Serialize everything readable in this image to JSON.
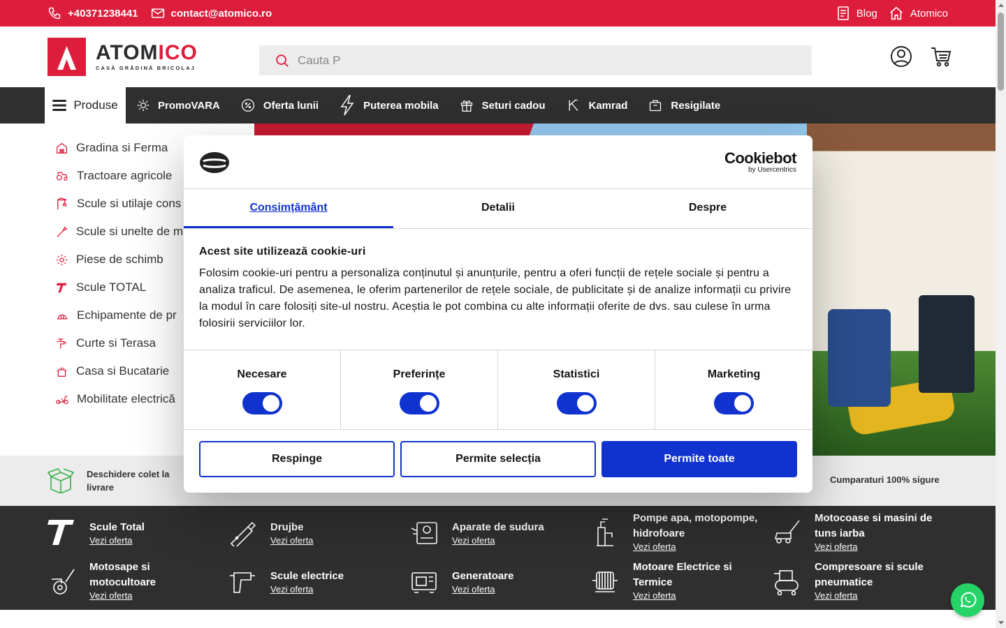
{
  "topbar": {
    "phone": "+40371238441",
    "email": "contact@atomico.ro",
    "blog": "Blog",
    "home": "Atomico"
  },
  "logo": {
    "brand_a": "ATOM",
    "brand_b": "ICO",
    "tagline": "CASĂ GRĂDINĂ BRICOLAJ"
  },
  "search": {
    "placeholder": "Cauta P"
  },
  "nav": {
    "products": "Produse",
    "items": [
      "PromoVARA",
      "Oferta lunii",
      "Puterea mobila",
      "Seturi cadou",
      "Kamrad",
      "Resigilate"
    ]
  },
  "categories": [
    "Gradina si Ferma",
    "Tractoare agricole",
    "Scule si utilaje cons",
    "Scule si unelte de m",
    "Piese de schimb",
    "Scule TOTAL",
    "Echipamente de pr",
    "Curte si Terasa",
    "Casa si Bucatarie",
    "Mobilitate electrică"
  ],
  "benefits": {
    "left": "Deschidere colet la livrare",
    "right": "Cumparaturi 100% sigure"
  },
  "category_grid": [
    {
      "title": "Scule Total",
      "link": "Vezi oferta"
    },
    {
      "title": "Drujbe",
      "link": "Vezi oferta"
    },
    {
      "title": "Aparate de sudura",
      "link": "Vezi oferta"
    },
    {
      "title": "Pompe apa, motopompe, hidrofoare",
      "link": "Vezi oferta"
    },
    {
      "title": "Motocoase si masini de tuns iarba",
      "link": "Vezi oferta"
    },
    {
      "title": "Motosape si motocultoare",
      "link": "Vezi oferta"
    },
    {
      "title": "Scule electrice",
      "link": "Vezi oferta"
    },
    {
      "title": "Generatoare",
      "link": "Vezi oferta"
    },
    {
      "title": "Motoare Electrice si Termice",
      "link": "Vezi oferta"
    },
    {
      "title": "Compresoare si scule pneumatice",
      "link": "Vezi oferta"
    }
  ],
  "cookie": {
    "brand": "Cookiebot",
    "brand_sub": "by Usercentrics",
    "tabs": [
      "Consimțământ",
      "Detalii",
      "Despre"
    ],
    "heading": "Acest site utilizează cookie-uri",
    "text": "Folosim cookie-uri pentru a personaliza conținutul și anunțurile, pentru a oferi funcții de rețele sociale și pentru a analiza traficul. De asemenea, le oferim partenerilor de rețele sociale, de publicitate și de analize informații cu privire la modul în care folosiți site-ul nostru. Aceștia le pot combina cu alte informații oferite de dvs. sau culese în urma folosirii serviciilor lor.",
    "toggles": [
      "Necesare",
      "Preferințe",
      "Statistici",
      "Marketing"
    ],
    "buttons": {
      "deny": "Respinge",
      "selection": "Permite selecția",
      "all": "Permite toate"
    }
  },
  "colors": {
    "brand_red": "#dd1d3c",
    "dark": "#2f2f2f",
    "cookie_blue": "#1032cf",
    "whatsapp": "#25d366"
  }
}
